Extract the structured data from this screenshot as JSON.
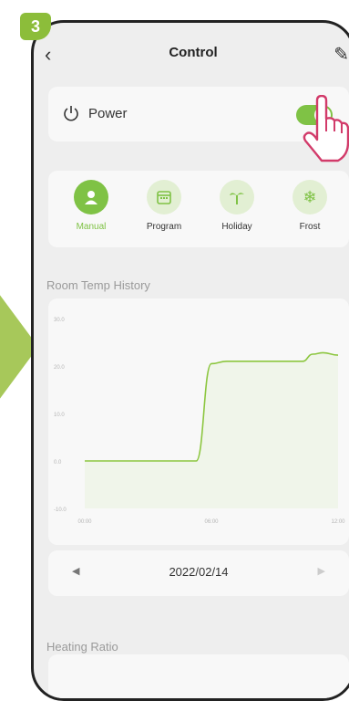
{
  "step": {
    "number": "3"
  },
  "header": {
    "back_icon": "chevron-left-icon",
    "title": "Control",
    "edit_icon": "pencil-icon"
  },
  "power": {
    "label": "Power",
    "state": "on",
    "toggle_color": "#7fc245"
  },
  "modes": [
    {
      "label": "Manual",
      "icon": "person-icon",
      "active": true
    },
    {
      "label": "Program",
      "icon": "calendar-icon",
      "active": false
    },
    {
      "label": "Holiday",
      "icon": "palm-tree-icon",
      "active": false
    },
    {
      "label": "Frost",
      "icon": "snowflake-icon",
      "active": false
    }
  ],
  "history": {
    "title": "Room Temp History",
    "chart_data": {
      "type": "line",
      "y_ticks": [
        "30.0",
        "20.0",
        "10.0",
        "0.0",
        "-10.0"
      ],
      "x_ticks": [
        "00:00",
        "06:00",
        "12:00"
      ],
      "ylim": [
        -10,
        30
      ],
      "x": [
        0,
        0.4,
        0.44,
        0.5,
        0.56,
        0.64,
        0.74,
        0.86,
        0.9,
        0.94,
        1.0
      ],
      "values": [
        0,
        0,
        0,
        20.5,
        21,
        21,
        21,
        21,
        22.5,
        22.8,
        22.3
      ],
      "color": "#8cc63f"
    }
  },
  "date_nav": {
    "prev": "◀",
    "date": "2022/02/14",
    "next": "▶"
  },
  "heating": {
    "title": "Heating Ratio"
  }
}
